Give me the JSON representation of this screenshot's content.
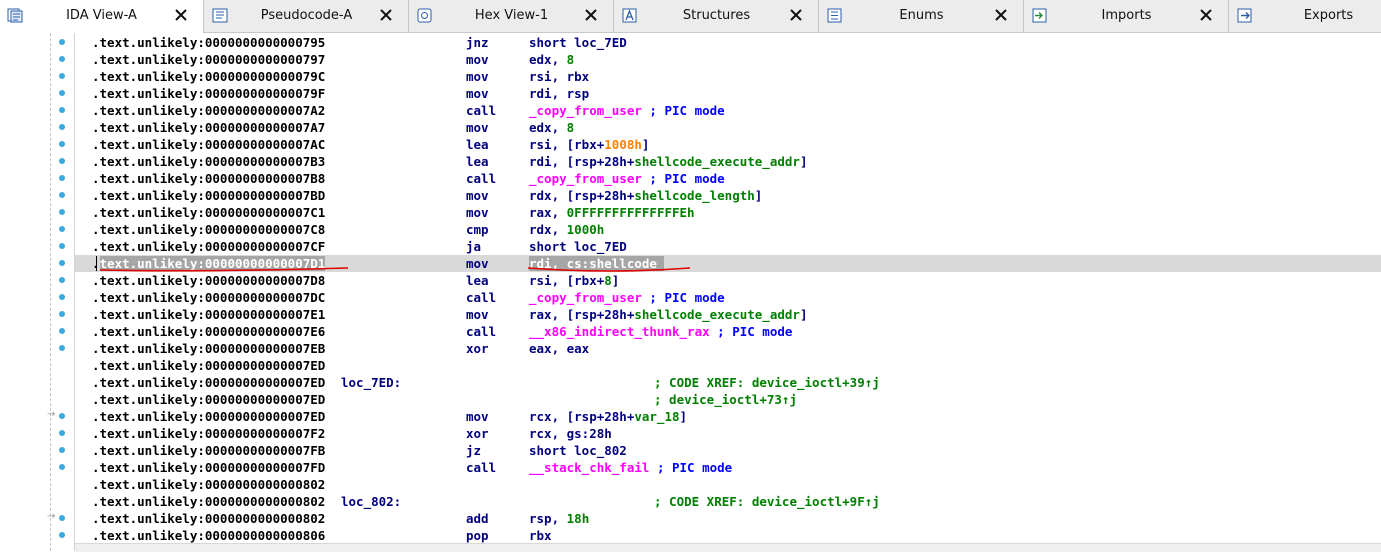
{
  "tabs": [
    {
      "label": "IDA View-A",
      "icon": "ida-view-icon",
      "active": true,
      "closable": true
    },
    {
      "label": "Pseudocode-A",
      "icon": "pseudocode-icon",
      "active": false,
      "closable": true
    },
    {
      "label": "Hex View-1",
      "icon": "hex-view-icon",
      "active": false,
      "closable": true
    },
    {
      "label": "Structures",
      "icon": "structures-icon",
      "active": false,
      "closable": true
    },
    {
      "label": "Enums",
      "icon": "enums-icon",
      "active": false,
      "closable": true
    },
    {
      "label": "Imports",
      "icon": "imports-icon",
      "active": false,
      "closable": true
    },
    {
      "label": "Exports",
      "icon": "exports-icon",
      "active": false,
      "closable": false
    }
  ],
  "colors": {
    "address": "#000000",
    "mnemonic": "#00007f",
    "symbol": "#ff00ff",
    "number": "#008000",
    "hex_immediate": "#ff8000",
    "comment": "#0000ff",
    "xref": "#008000",
    "highlight_row": "#d9d9d9",
    "selection": "#a6a6a6",
    "gutter_dot": "#3aa9e0",
    "annotation_ink": "#e00000"
  },
  "listing": {
    "rows": [
      {
        "addr": ".text.unlikely:0000000000000795",
        "label": "",
        "mnem": "jnz",
        "ops": "short loc_7ED"
      },
      {
        "addr": ".text.unlikely:0000000000000797",
        "label": "",
        "mnem": "mov",
        "ops": "edx, 8"
      },
      {
        "addr": ".text.unlikely:000000000000079C",
        "label": "",
        "mnem": "mov",
        "ops": "rsi, rbx"
      },
      {
        "addr": ".text.unlikely:000000000000079F",
        "label": "",
        "mnem": "mov",
        "ops": "rdi, rsp"
      },
      {
        "addr": ".text.unlikely:00000000000007A2",
        "label": "",
        "mnem": "call",
        "ops": "_copy_from_user ; PIC mode"
      },
      {
        "addr": ".text.unlikely:00000000000007A7",
        "label": "",
        "mnem": "mov",
        "ops": "edx, 8"
      },
      {
        "addr": ".text.unlikely:00000000000007AC",
        "label": "",
        "mnem": "lea",
        "ops": "rsi, [rbx+1008h]"
      },
      {
        "addr": ".text.unlikely:00000000000007B3",
        "label": "",
        "mnem": "lea",
        "ops": "rdi, [rsp+28h+shellcode_execute_addr]"
      },
      {
        "addr": ".text.unlikely:00000000000007B8",
        "label": "",
        "mnem": "call",
        "ops": "_copy_from_user ; PIC mode"
      },
      {
        "addr": ".text.unlikely:00000000000007BD",
        "label": "",
        "mnem": "mov",
        "ops": "rdx, [rsp+28h+shellcode_length]"
      },
      {
        "addr": ".text.unlikely:00000000000007C1",
        "label": "",
        "mnem": "mov",
        "ops": "rax, 0FFFFFFFFFFFFFFEh"
      },
      {
        "addr": ".text.unlikely:00000000000007C8",
        "label": "",
        "mnem": "cmp",
        "ops": "rdx, 1000h"
      },
      {
        "addr": ".text.unlikely:00000000000007CF",
        "label": "",
        "mnem": "ja",
        "ops": "short loc_7ED"
      },
      {
        "addr": ".text.unlikely:00000000000007D1",
        "label": "",
        "mnem": "mov",
        "ops": "rdi, cs:shellcode"
      },
      {
        "addr": ".text.unlikely:00000000000007D8",
        "label": "",
        "mnem": "lea",
        "ops": "rsi, [rbx+8]"
      },
      {
        "addr": ".text.unlikely:00000000000007DC",
        "label": "",
        "mnem": "call",
        "ops": "_copy_from_user ; PIC mode"
      },
      {
        "addr": ".text.unlikely:00000000000007E1",
        "label": "",
        "mnem": "mov",
        "ops": "rax, [rsp+28h+shellcode_execute_addr]"
      },
      {
        "addr": ".text.unlikely:00000000000007E6",
        "label": "",
        "mnem": "call",
        "ops": "__x86_indirect_thunk_rax ; PIC mode"
      },
      {
        "addr": ".text.unlikely:00000000000007EB",
        "label": "",
        "mnem": "xor",
        "ops": "eax, eax"
      },
      {
        "addr": ".text.unlikely:00000000000007ED",
        "label": "",
        "mnem": "",
        "ops": ""
      },
      {
        "addr": ".text.unlikely:00000000000007ED",
        "label": "loc_7ED:",
        "mnem": "",
        "ops": "",
        "xref": "; CODE XREF: device_ioctl+39↑j"
      },
      {
        "addr": ".text.unlikely:00000000000007ED",
        "label": "",
        "mnem": "",
        "ops": "",
        "xref": "; device_ioctl+73↑j"
      },
      {
        "addr": ".text.unlikely:00000000000007ED",
        "label": "",
        "mnem": "mov",
        "ops": "rcx, [rsp+28h+var_18]"
      },
      {
        "addr": ".text.unlikely:00000000000007F2",
        "label": "",
        "mnem": "xor",
        "ops": "rcx, gs:28h"
      },
      {
        "addr": ".text.unlikely:00000000000007FB",
        "label": "",
        "mnem": "jz",
        "ops": "short loc_802"
      },
      {
        "addr": ".text.unlikely:00000000000007FD",
        "label": "",
        "mnem": "call",
        "ops": "__stack_chk_fail ; PIC mode"
      },
      {
        "addr": ".text.unlikely:0000000000000802",
        "label": "",
        "mnem": "",
        "ops": ""
      },
      {
        "addr": ".text.unlikely:0000000000000802",
        "label": "loc_802:",
        "mnem": "",
        "ops": "",
        "xref": "; CODE XREF: device_ioctl+9F↑j"
      },
      {
        "addr": ".text.unlikely:0000000000000802",
        "label": "",
        "mnem": "add",
        "ops": "rsp, 18h"
      },
      {
        "addr": ".text.unlikely:0000000000000806",
        "label": "",
        "mnem": "pop",
        "ops": "rbx"
      }
    ],
    "selected_row": 13
  }
}
